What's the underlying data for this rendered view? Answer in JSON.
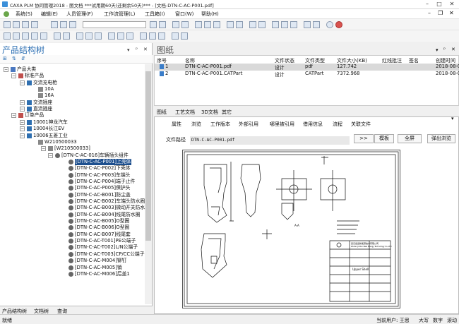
{
  "window": {
    "title": "CAXA PLM 协同管理2018 - 图文档   ***试用期60天(还剩余50天)***  - [文档-DTN-C-AC-P001.pdf]"
  },
  "menu": [
    "系统(S)",
    "编辑(E)",
    "人员管理(F)",
    "工作流管理(L)",
    "工具箱(I)",
    "窗口(W)",
    "帮助(H)"
  ],
  "left_panel": {
    "title": "产品结构树",
    "tree": [
      {
        "label": "产品大类",
        "level": 0
      },
      {
        "label": "标准产品",
        "level": 1
      },
      {
        "label": "交流充电枪",
        "level": 2
      },
      {
        "label": "10A",
        "level": 3
      },
      {
        "label": "16A",
        "level": 3
      },
      {
        "label": "交流插座",
        "level": 2
      },
      {
        "label": "直流插座",
        "level": 2
      },
      {
        "label": "订单产品",
        "level": 1
      },
      {
        "label": "10001神龙汽车",
        "level": 2
      },
      {
        "label": "10004长江EV",
        "level": 2
      },
      {
        "label": "10006五菱工业",
        "level": 2
      },
      {
        "label": "W210500033",
        "level": 3
      },
      {
        "label": "[W210500033]",
        "level": 4
      },
      {
        "label": "[DTN-C-AC-016]车辆插头组件",
        "level": 5
      },
      {
        "label": "[DTN-C-AC-P001]上壳体",
        "level": 6,
        "selected": true
      },
      {
        "label": "[DTN-C-AC-P002]下壳体",
        "level": 6
      },
      {
        "label": "[DTN-C-AC-P003]车端头",
        "level": 6
      },
      {
        "label": "[DTN-C-AC-P004]端子止件",
        "level": 6
      },
      {
        "label": "[DTN-C-AC-P005]保护头",
        "level": 6
      },
      {
        "label": "[DTN-C-AC-B001]防尘盖",
        "level": 6
      },
      {
        "label": "[DTN-C-AC-B002]车端头防水圈",
        "level": 6
      },
      {
        "label": "[DTN-C-AC-B003]微动开关防水圈",
        "level": 6
      },
      {
        "label": "[DTN-C-AC-B004]线尾防水圈",
        "level": 6
      },
      {
        "label": "[DTN-C-AC-B005]O型圈",
        "level": 6
      },
      {
        "label": "[DTN-C-AC-B006]O型圈",
        "level": 6
      },
      {
        "label": "[DTN-C-AC-B007]线尾套",
        "level": 6
      },
      {
        "label": "[DTN-C-AC-T001]PE公端子",
        "level": 6
      },
      {
        "label": "[DTN-C-AC-T002]L/N公端子",
        "level": 6
      },
      {
        "label": "[DTN-C-AC-T003]CP/CC公端子",
        "level": 6
      },
      {
        "label": "[DTN-C-AC-M004]铆钉",
        "level": 6
      },
      {
        "label": "[DTN-C-AC-M005]销",
        "level": 6
      },
      {
        "label": "[DTN-C-AC-M006]后盖1",
        "level": 6
      }
    ],
    "bottom_tabs": [
      "产品结构树",
      "文档树",
      "查询"
    ]
  },
  "right_panel": {
    "title": "图纸",
    "columns": [
      "序号",
      "名称",
      "文件状态",
      "文件类型",
      "文件大小(KB)",
      "红线批注",
      "签名",
      "创建时间"
    ],
    "rows": [
      {
        "no": "1",
        "name": "DTN-C-AC-P001.pdf",
        "status": "设计",
        "type": "pdf",
        "size": "127.742",
        "created": "2018-08-0"
      },
      {
        "no": "2",
        "name": "DTN-C-AC-P001.CATPart",
        "status": "设计",
        "type": "CATPart",
        "size": "7372.968",
        "created": "2018-08-0"
      }
    ],
    "bottom_tabs": [
      "图纸",
      "工艺文档",
      "3D文档",
      "其它"
    ]
  },
  "doc_view": {
    "tabs": [
      "属性",
      "浏览",
      "工作版本",
      "外部引用",
      "哪里被引用",
      "借用信息",
      "流程",
      "关联文件"
    ],
    "path_label": "文件路径",
    "path_value": "DTN-C-AC-P001.pdf",
    "btn_more": ">>",
    "btn_template": "模板",
    "btn_fullscreen": "全屏",
    "btn_popup": "弹出浏览",
    "drawing_text": {
      "section": "A-A",
      "part_name": "Upper Shell",
      "company_cn": "武汉嘉运新能源技术有限公司",
      "company_en": "Wuhan JiaYun New Energy Technology Co.,LTD"
    }
  },
  "status_bar": {
    "left": "就绪",
    "user": "当前用户: 王思",
    "caps": "大写",
    "num": "数字",
    "scroll": "滚动"
  }
}
